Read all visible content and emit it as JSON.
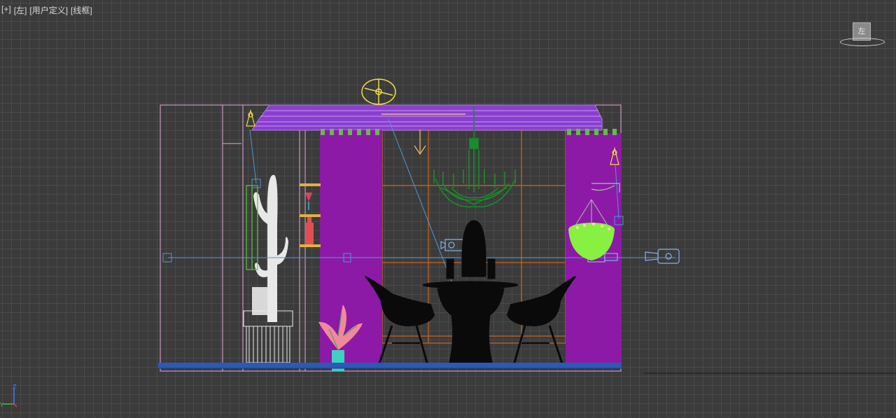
{
  "viewport": {
    "label_plus": "[+]",
    "label_view": "[左]",
    "label_mode": "[用户定义]",
    "label_shading": "[线框]"
  },
  "viewcube": {
    "face_label": "左"
  },
  "axis": {
    "z_label": "Z",
    "y_label": "Y"
  },
  "colors": {
    "background": "#3b3b3b",
    "grid": "#4a4a4a",
    "room_outline": "#e6a8d8",
    "curtain": "#8c1aa6",
    "valance": "#9a58d8",
    "chandelier": "#1a8c2a",
    "window_frame": "#c8641e",
    "furniture": "#000000",
    "cactus": "#e8e8e8",
    "plant_leaves": "#f08a9a",
    "plant_pot": "#40d0c0",
    "hanging_plant": "#88f040",
    "floor": "#2a5ab8",
    "light_icon": "#f0e040",
    "camera_icon": "#6a9ad8",
    "target_line": "#4a9ad8"
  }
}
